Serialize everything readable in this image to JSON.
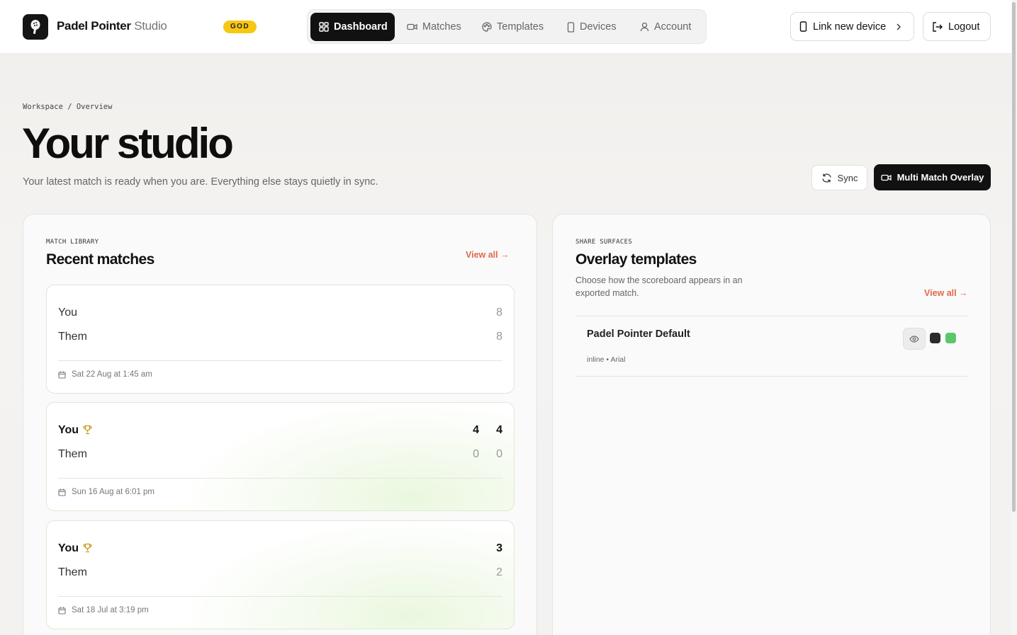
{
  "app": {
    "brand_main": "Padel Pointer",
    "brand_sub": "Studio",
    "badge": "GOD"
  },
  "nav": {
    "items": [
      {
        "label": "Dashboard",
        "icon": "grid-icon",
        "active": true
      },
      {
        "label": "Matches",
        "icon": "video-icon",
        "active": false
      },
      {
        "label": "Templates",
        "icon": "palette-icon",
        "active": false
      },
      {
        "label": "Devices",
        "icon": "phone-icon",
        "active": false
      },
      {
        "label": "Account",
        "icon": "user-icon",
        "active": false
      }
    ]
  },
  "header_actions": {
    "link_device": "Link new device",
    "logout": "Logout"
  },
  "page": {
    "breadcrumb": "Workspace / Overview",
    "title": "Your studio",
    "subtitle": "Your latest match is ready when you are. Everything else stays quietly in sync.",
    "sync_label": "Sync",
    "overlay_label": "Multi Match Overlay"
  },
  "matches_panel": {
    "eyebrow": "MATCH LIBRARY",
    "title": "Recent matches",
    "view_all": "View all →",
    "matches": [
      {
        "p1": "You",
        "p2": "Them",
        "winner": null,
        "p1_scores": [
          "8"
        ],
        "p2_scores": [
          "8"
        ],
        "date": "Sat 22 Aug at 1:45 am"
      },
      {
        "p1": "You",
        "p2": "Them",
        "winner": "p1",
        "p1_scores": [
          "4",
          "4"
        ],
        "p2_scores": [
          "0",
          "0"
        ],
        "date": "Sun 16 Aug at 6:01 pm"
      },
      {
        "p1": "You",
        "p2": "Them",
        "winner": "p1",
        "p1_scores": [
          "3"
        ],
        "p2_scores": [
          "2"
        ],
        "date": "Sat 18 Jul at 3:19 pm"
      }
    ]
  },
  "templates_panel": {
    "eyebrow": "SHARE SURFACES",
    "title": "Overlay templates",
    "description": "Choose how the scoreboard appears in an exported match.",
    "view_all": "View all →",
    "templates": [
      {
        "name": "Padel Pointer Default",
        "meta": "inline • Arial",
        "colors": [
          "#2b2b2b",
          "#5ac86a"
        ]
      }
    ]
  },
  "colors": {
    "accent": "#e06a4c",
    "dark": "#111111",
    "badge": "#f6c814",
    "win_tint": "#eaf8df"
  }
}
